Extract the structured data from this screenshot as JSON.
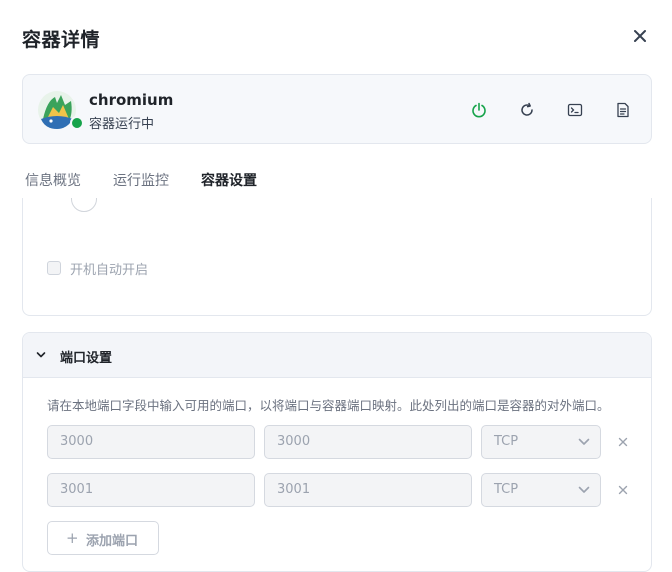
{
  "dialog": {
    "title": "容器详情"
  },
  "app": {
    "name": "chromium",
    "status": "容器运行中",
    "status_color": "#16a34a",
    "actions": [
      "power-icon",
      "restart-icon",
      "terminal-icon",
      "log-icon"
    ]
  },
  "tabs": [
    {
      "label": "信息概览",
      "active": false
    },
    {
      "label": "运行监控",
      "active": false
    },
    {
      "label": "容器设置",
      "active": true
    }
  ],
  "settings": {
    "autostart_label": "开机自动开启",
    "autostart_checked": false
  },
  "ports": {
    "section_title": "端口设置",
    "description": "请在本地端口字段中输入可用的端口，以将端口与容器端口映射。此处列出的端口是容器的对外端口。",
    "rows": [
      {
        "local": "3000",
        "container": "3000",
        "protocol": "TCP"
      },
      {
        "local": "3001",
        "container": "3001",
        "protocol": "TCP"
      }
    ],
    "add_label": "添加端口"
  },
  "colors": {
    "accent": "#3b6fd4",
    "running": "#16a34a"
  }
}
